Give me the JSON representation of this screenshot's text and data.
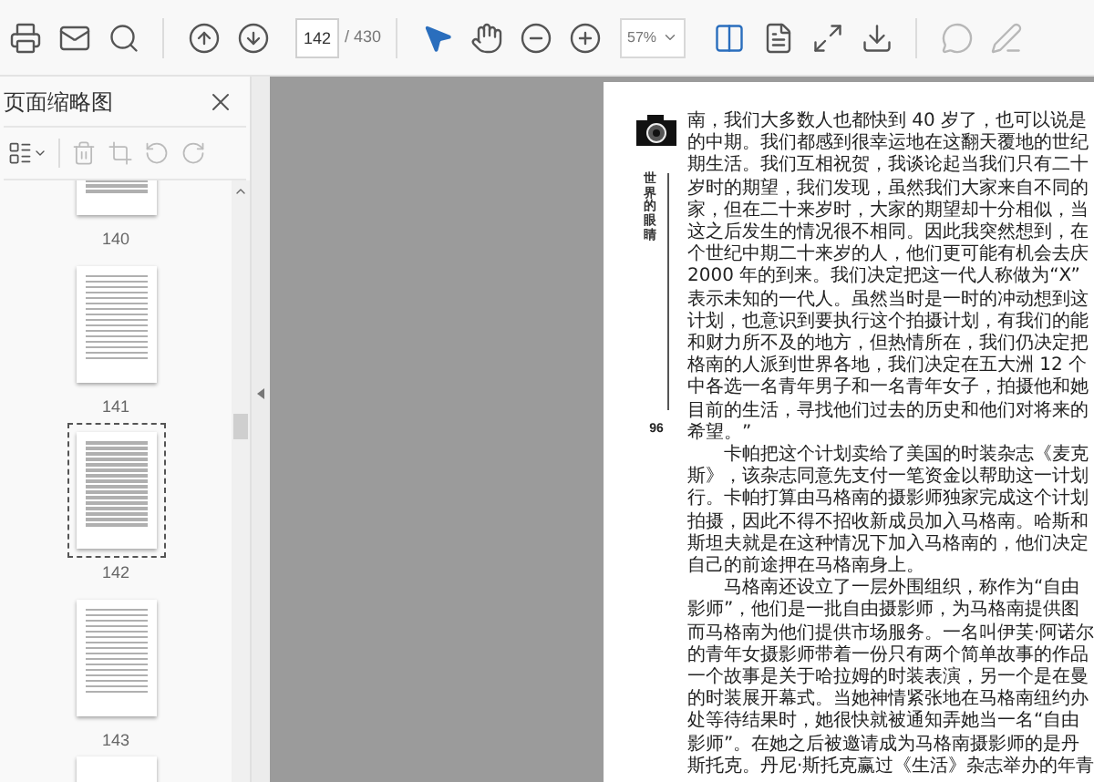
{
  "toolbar": {
    "tools": [
      {
        "kind": "print",
        "selected": false
      },
      {
        "kind": "mail",
        "selected": false
      },
      {
        "kind": "search",
        "selected": false
      },
      {
        "kind": "prev",
        "selected": false
      },
      {
        "kind": "next",
        "selected": false
      }
    ],
    "page_input": "142",
    "page_total": "/ 430",
    "view_tools": [
      {
        "kind": "select",
        "selected": true
      },
      {
        "kind": "hand",
        "selected": false
      },
      {
        "kind": "zoom_out",
        "selected": false
      },
      {
        "kind": "zoom_in",
        "selected": false
      }
    ],
    "zoom": "57%",
    "mode_tools": [
      {
        "kind": "scroll",
        "selected": true
      },
      {
        "kind": "fit",
        "selected": false
      },
      {
        "kind": "fullscreen",
        "selected": false
      },
      {
        "kind": "download",
        "selected": false
      }
    ],
    "markup_tools": [
      {
        "kind": "comment",
        "selected": false
      },
      {
        "kind": "pen",
        "selected": false
      }
    ]
  },
  "sidebar": {
    "title": "页面缩略图",
    "thumbnails": [
      {
        "label": "140",
        "selected": false
      },
      {
        "label": "141",
        "selected": false
      },
      {
        "label": "142",
        "selected": true
      },
      {
        "label": "143",
        "selected": false
      }
    ]
  },
  "page": {
    "side_title": "世界的眼睛",
    "page_number": "96",
    "lines": [
      {
        "text": "南，我们大多数人也都快到 40 岁了，也可以说是",
        "indent": false
      },
      {
        "text": "的中期。我们都感到很幸运地在这翻天覆地的世纪",
        "indent": false
      },
      {
        "text": "期生活。我们互相祝贺，我谈论起当我们只有二十",
        "indent": false
      },
      {
        "text": "岁时的期望，我们发现，虽然我们大家来自不同的",
        "indent": false
      },
      {
        "text": "家，但在二十来岁时，大家的期望却十分相似，当",
        "indent": false
      },
      {
        "text": "这之后发生的情况很不相同。因此我突然想到，在",
        "indent": false
      },
      {
        "text": "个世纪中期二十来岁的人，他们更可能有机会去庆",
        "indent": false
      },
      {
        "text": "2000 年的到来。我们决定把这一代人称做为“X”",
        "indent": false
      },
      {
        "text": "表示未知的一代人。虽然当时是一时的冲动想到这",
        "indent": false
      },
      {
        "text": "计划，也意识到要执行这个拍摄计划，有我们的能",
        "indent": false
      },
      {
        "text": "和财力所不及的地方，但热情所在，我们仍决定把",
        "indent": false
      },
      {
        "text": "格南的人派到世界各地，我们决定在五大洲 12 个",
        "indent": false
      },
      {
        "text": "中各选一名青年男子和一名青年女子，拍摄他和她",
        "indent": false
      },
      {
        "text": "目前的生活，寻找他们过去的历史和他们对将来的",
        "indent": false
      },
      {
        "text": "希望。”",
        "indent": false
      },
      {
        "text": "卡帕把这个计划卖给了美国的时装杂志《麦克",
        "indent": true
      },
      {
        "text": "斯》，该杂志同意先支付一笔资金以帮助这一计划",
        "indent": false
      },
      {
        "text": "行。卡帕打算由马格南的摄影师独家完成这个计划",
        "indent": false
      },
      {
        "text": "拍摄，因此不得不招收新成员加入马格南。哈斯和",
        "indent": false
      },
      {
        "text": "斯坦夫就是在这种情况下加入马格南的，他们决定",
        "indent": false
      },
      {
        "text": "自己的前途押在马格南身上。",
        "indent": false
      },
      {
        "text": "马格南还设立了一层外围组织，称作为“自由",
        "indent": true
      },
      {
        "text": "影师”，他们是一批自由摄影师，为马格南提供图",
        "indent": false
      },
      {
        "text": "而马格南为他们提供市场服务。一名叫伊芙·阿诺尔",
        "indent": false
      },
      {
        "text": "的青年女摄影师带着一份只有两个简单故事的作品",
        "indent": false
      },
      {
        "text": "一个故事是关于哈拉姆的时装表演，另一个是在曼",
        "indent": false
      },
      {
        "text": "的时装展开幕式。当她神情紧张地在马格南纽约办",
        "indent": false
      },
      {
        "text": "处等待结果时，她很快就被通知弄她当一名“自由",
        "indent": false
      },
      {
        "text": "影师”。在她之后被邀请成为马格南摄影师的是丹",
        "indent": false
      },
      {
        "text": "斯托克。丹尼·斯托克赢过《生活》杂志举办的年青",
        "indent": false
      }
    ]
  }
}
